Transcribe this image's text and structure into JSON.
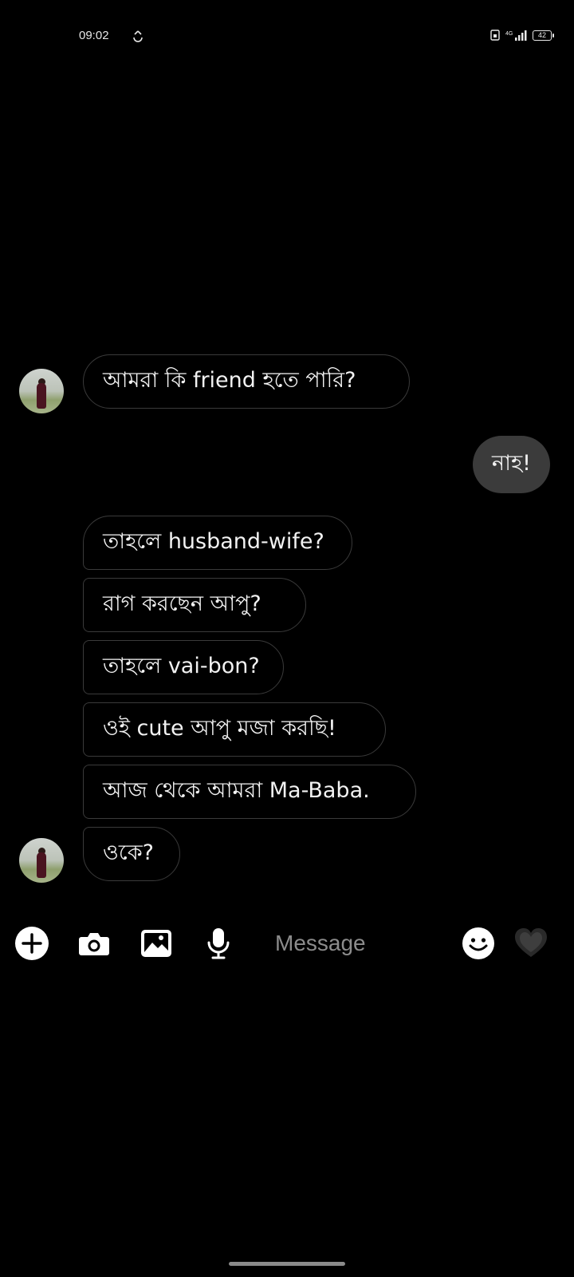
{
  "status_bar": {
    "time": "09:02",
    "battery": "42",
    "icons": [
      "sync-icon",
      "sim-icon",
      "signal-icon",
      "battery-icon"
    ]
  },
  "conversation": {
    "messages": [
      {
        "sender": "other",
        "text": "আমরা কি friend  হতে পারি?"
      },
      {
        "sender": "me",
        "text": "নাহ!"
      },
      {
        "sender": "other",
        "text": "তাহলে husband-wife?"
      },
      {
        "sender": "other",
        "text": "রাগ করছেন আপু?"
      },
      {
        "sender": "other",
        "text": "তাহলে vai-bon?"
      },
      {
        "sender": "other",
        "text": "ওই cute আপু মজা করছি!"
      },
      {
        "sender": "other",
        "text": "আজ থেকে আমরা Ma-Baba."
      },
      {
        "sender": "other",
        "text": "ওকে?"
      }
    ]
  },
  "composer": {
    "placeholder": "Message",
    "icons": [
      "add-icon",
      "camera-icon",
      "gallery-icon",
      "microphone-icon",
      "emoji-icon",
      "heart-icon"
    ]
  },
  "colors": {
    "background": "#000000",
    "sent_bubble": "#3b3b3b",
    "received_border": "#3a3a3a",
    "text": "#f2f2f2",
    "placeholder": "#8c8c8c"
  }
}
